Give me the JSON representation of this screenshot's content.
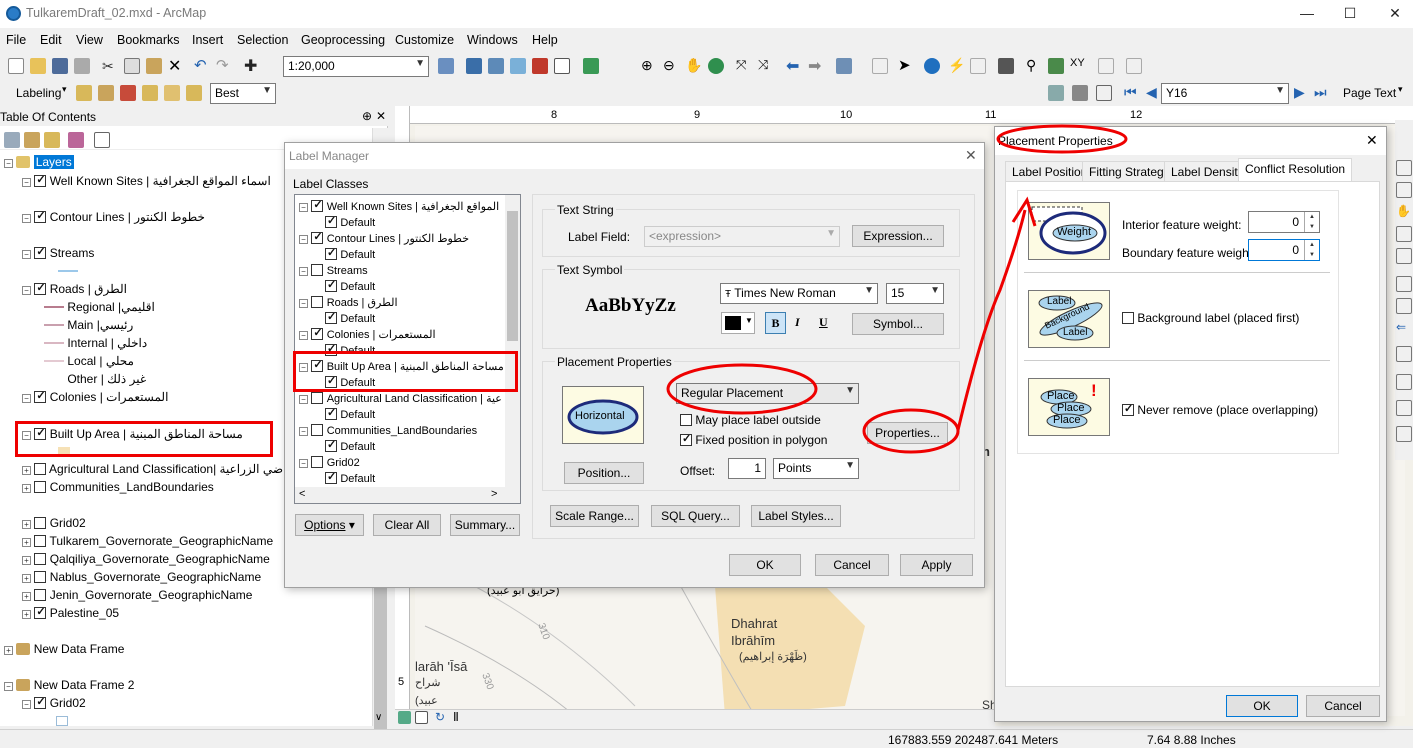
{
  "window": {
    "title": "TulkaremDraft_02.mxd - ArcMap"
  },
  "menu": [
    "File",
    "Edit",
    "View",
    "Bookmarks",
    "Insert",
    "Selection",
    "Geoprocessing",
    "Customize",
    "Windows",
    "Help"
  ],
  "toolbar": {
    "scale": "1:20,000",
    "labeling_label": "Labeling",
    "best_label": "Best",
    "layer_combo": "Y16",
    "page_text": "Page Text"
  },
  "toc": {
    "title": "Table Of Contents",
    "root": "Layers",
    "items": {
      "well_known": "Well Known Sites | اسماء المواقع الجغرافية",
      "contour": "Contour Lines | خطوط الكنتور",
      "streams": "Streams",
      "roads": "Roads | الطرق",
      "regional": "Regional |اقليمي",
      "main": "Main |رئيسي",
      "internal": "Internal | داخلي",
      "local": "Local | محلي",
      "other": "Other | غير ذلك",
      "colonies": "Colonies | المستعمرات",
      "builtup": "Built Up Area | مساحة المناطق المبنية",
      "agri": "Agricultural Land Classification| أراضي الزراعية",
      "communities": "Communities_LandBoundaries",
      "grid02": "Grid02",
      "tulkarem": "Tulkarem_Governorate_GeographicName",
      "qalqiliya": "Qalqiliya_Governorate_GeographicName",
      "nablus": "Nablus_Governorate_GeographicName",
      "jenin": "Jenin_Governorate_GeographicName",
      "palestine": "Palestine_05",
      "ndf": "New Data Frame",
      "ndf2": "New Data Frame 2",
      "grid02b": "Grid02"
    }
  },
  "map": {
    "ruler_marks": [
      "8",
      "9",
      "10",
      "11",
      "12"
    ],
    "label_harayeq": "(حرايق أبو عبيد)",
    "label_dhahrat": "Dhahrat",
    "label_ibrahim": "Ibrāhīm",
    "label_ibrahim_ar": "(ظَهْرَة إبراهيم)",
    "label_isa": "larāh 'Īsā",
    "label_isa_ar": "شراح",
    "label_abeed": "(عبيد",
    "contour_310": "310",
    "contour_330": "330",
    "sh": "Sh",
    "n_letter": "n",
    "ruler_left_5": "5"
  },
  "label_manager": {
    "title": "Label Manager",
    "classes_label": "Label Classes",
    "classes": [
      {
        "name": "Well Known Sites | المواقع الجغرافية",
        "checked": true
      },
      {
        "name": "Contour Lines | خطوط الكنتور",
        "checked": true
      },
      {
        "name": "Streams",
        "checked": false
      },
      {
        "name": "Roads | الطرق",
        "checked": false
      },
      {
        "name": "Colonies | المستعمرات",
        "checked": true
      },
      {
        "name": "Built Up Area | مساحة المناطق المبنية",
        "checked": true
      },
      {
        "name": "Agricultural Land Classification | عية",
        "checked": false
      },
      {
        "name": "Communities_LandBoundaries",
        "checked": false
      },
      {
        "name": "Grid02",
        "checked": false
      }
    ],
    "default_label": "Default",
    "text_string": "Text String",
    "label_field": "Label Field:",
    "expression_value": "<expression>",
    "expression_btn": "Expression...",
    "text_symbol": "Text Symbol",
    "sample": "AaBbYyZz",
    "font": "Times New Roman",
    "size": "15",
    "bold": "B",
    "italic": "I",
    "underline": "U",
    "symbol_btn": "Symbol...",
    "placement_props": "Placement Properties",
    "horizontal": "Horizontal",
    "placement_mode": "Regular Placement",
    "may_place": "May place label outside",
    "fixed_position": "Fixed position in polygon",
    "position_btn": "Position...",
    "offset_label": "Offset:",
    "offset_value": "1",
    "offset_units": "Points",
    "properties_btn": "Properties...",
    "options_btn": "Options",
    "clear_all_btn": "Clear All",
    "summary_btn": "Summary...",
    "scale_range_btn": "Scale Range...",
    "sql_btn": "SQL Query...",
    "label_styles_btn": "Label Styles...",
    "ok": "OK",
    "cancel": "Cancel",
    "apply": "Apply"
  },
  "placement_dialog": {
    "title": "Placement Properties",
    "tabs": [
      "Label Position",
      "Fitting Strategy",
      "Label Density",
      "Conflict Resolution"
    ],
    "weight_word": "Weight",
    "interior_label": "Interior feature weight:",
    "interior_value": "0",
    "boundary_label": "Boundary feature weight:",
    "boundary_value": "0",
    "pic_label": "Label",
    "pic_background": "Background",
    "background_label": "Background label (placed first)",
    "pic_place": "Place",
    "never_remove": "Never remove (place overlapping)",
    "ok": "OK",
    "cancel": "Cancel"
  },
  "status": {
    "coords": "167883.559  202487.641 Meters",
    "page": "7.64  8.88 Inches"
  },
  "colors": {
    "annotation_red": "#e00000",
    "selection_blue": "#0078d7"
  }
}
